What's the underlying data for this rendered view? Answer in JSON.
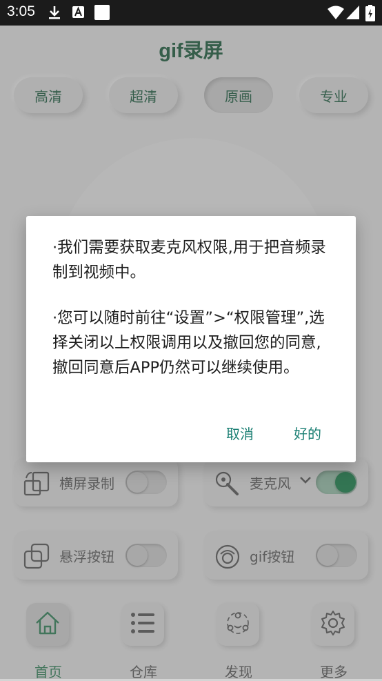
{
  "status_bar": {
    "time": "3:05",
    "notification_icons": [
      "download-icon",
      "a-icon",
      "white-square-icon"
    ],
    "system_icons": [
      "wifi-icon",
      "signal-icon",
      "battery-icon"
    ]
  },
  "app": {
    "title": "gif录屏",
    "quality_tabs": [
      {
        "label": "高清"
      },
      {
        "label": "超清"
      },
      {
        "label": "原画",
        "active": true
      },
      {
        "label": "专业"
      }
    ]
  },
  "settings": [
    {
      "label": "横屏录制",
      "icon": "rotate-screen-icon",
      "toggle_on": false
    },
    {
      "label": "麦克风",
      "icon": "microphone-icon",
      "toggle_on": true,
      "has_dropdown": true
    },
    {
      "label": "悬浮按钮",
      "icon": "float-window-icon",
      "toggle_on": false
    },
    {
      "label": "gif按钮",
      "icon": "gif-button-icon",
      "toggle_on": false
    }
  ],
  "bottom_nav": [
    {
      "label": "首页",
      "icon": "home-icon",
      "active": true
    },
    {
      "label": "仓库",
      "icon": "list-icon"
    },
    {
      "label": "发现",
      "icon": "discover-icon"
    },
    {
      "label": "更多",
      "icon": "gear-icon"
    }
  ],
  "dialog": {
    "paragraph1": "·我们需要获取麦克风权限,用于把音频录制到视频中。",
    "paragraph2": "·您可以随时前往“设置”>“权限管理”,选择关闭以上权限调用以及撤回您的同意,撤回同意后APP仍然可以继续使用。",
    "cancel_label": "取消",
    "ok_label": "好的"
  },
  "colors": {
    "accent": "#41705b",
    "dialog_button": "#1a7f73",
    "background": "#d4d4d4",
    "status_bar": "#1b1b1b"
  }
}
